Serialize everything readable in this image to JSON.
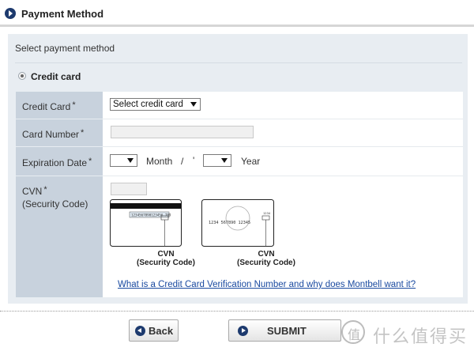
{
  "header": {
    "title": "Payment Method",
    "icon": "arrow-circle-icon"
  },
  "panel": {
    "intro": "Select payment method",
    "option_label": "Credit card",
    "option_selected": true
  },
  "form": {
    "rows": {
      "credit_card": {
        "label": "Credit Card",
        "required": "*",
        "select_value": "Select credit card"
      },
      "card_number": {
        "label": "Card Number",
        "required": "*",
        "value": ""
      },
      "expiration": {
        "label": "Expiration Date",
        "required": "*",
        "month_value": "",
        "month_label": "Month",
        "slash": "/",
        "tick": "'",
        "year_value": "",
        "year_label": "Year"
      },
      "cvn": {
        "label": "CVN",
        "required": "*",
        "sublabel": "(Security Code)",
        "value": "",
        "card_back": {
          "digits": "1234567890123456 789",
          "caption_line1": "CVN",
          "caption_line2": "(Security Code)"
        },
        "card_front": {
          "digits": "1234  567890  12345",
          "corner": "1234",
          "caption_line1": "CVN",
          "caption_line2": "(Security Code)"
        },
        "help_link": "What is a Credit Card Verification Number and why does Montbell want it?"
      }
    }
  },
  "buttons": {
    "back": "Back",
    "submit": "SUBMIT"
  },
  "watermark": {
    "text": "什么值得买",
    "logo_glyph": "值"
  },
  "colors": {
    "navy": "#1d3a6e",
    "panel_bg": "#e8edf2",
    "label_bg": "#c8d2dd",
    "link": "#1a4aa0"
  }
}
